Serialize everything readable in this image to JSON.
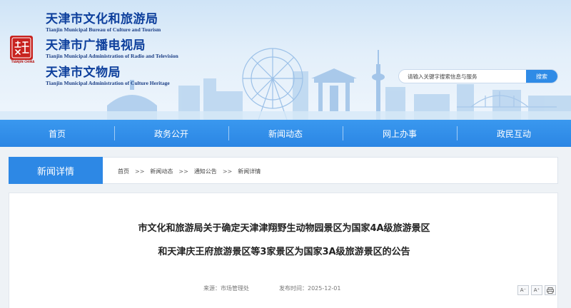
{
  "colors": {
    "accent": "#2d88e5",
    "title_blue": "#0d3f9c",
    "seal_red": "#c8231f"
  },
  "header": {
    "seal_text": "TIANJIN CHINA",
    "departments": [
      {
        "cn": "天津市文化和旅游局",
        "en": "Tianjin Municipal Bureau of Culture and Tourism"
      },
      {
        "cn": "天津市广播电视局",
        "en": "Tianjin Municipal Administration of Radio and Television"
      },
      {
        "cn": "天津市文物局",
        "en": "Tianjin Municipal Administration of Culture Heritage"
      }
    ],
    "search": {
      "placeholder": "请输入关键字搜索信息与服务",
      "button_label": "搜索"
    }
  },
  "nav": {
    "items": [
      {
        "label": "首页"
      },
      {
        "label": "政务公开"
      },
      {
        "label": "新闻动态"
      },
      {
        "label": "网上办事"
      },
      {
        "label": "政民互动"
      }
    ]
  },
  "section": {
    "tab_label": "新闻详情",
    "breadcrumb": [
      "首页",
      "新闻动态",
      "通知公告",
      "新闻详情"
    ],
    "separator": ">>"
  },
  "article": {
    "title_line1": "市文化和旅游局关于确定天津津翔野生动物园景区为国家4A级旅游景区",
    "title_line2": "和天津庆王府旅游景区等3家景区为国家3A级旅游景区的公告",
    "source": "来源：市场管理处",
    "date": "发布时间：2025-12-01",
    "tools": [
      {
        "icon": "font-decrease-icon",
        "label": "A⁻"
      },
      {
        "icon": "font-increase-icon",
        "label": "A⁺"
      },
      {
        "icon": "print-icon",
        "label": ""
      }
    ]
  }
}
